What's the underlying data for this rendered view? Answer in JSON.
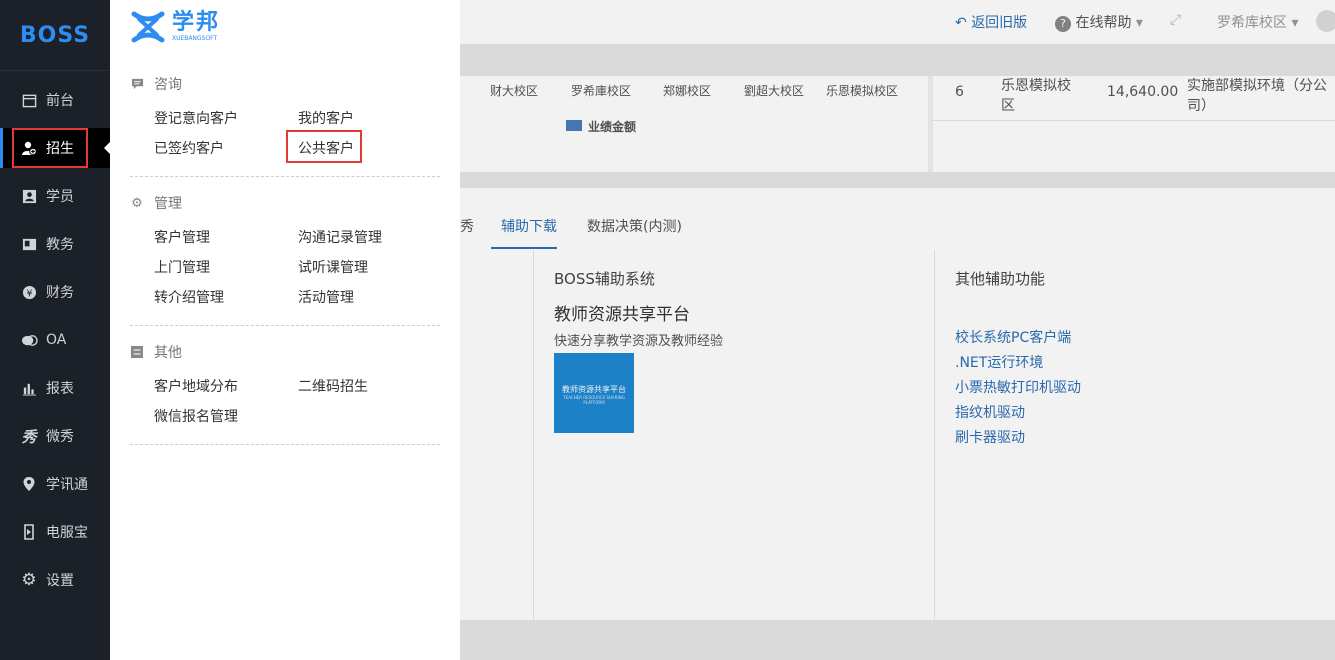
{
  "sidebar": {
    "logo": "BOSS",
    "items": [
      {
        "label": "前台",
        "icon": "calendar-icon"
      },
      {
        "label": "招生",
        "icon": "user-add-icon"
      },
      {
        "label": "学员",
        "icon": "student-card-icon"
      },
      {
        "label": "教务",
        "icon": "book-icon"
      },
      {
        "label": "财务",
        "icon": "yen-coin-icon"
      },
      {
        "label": "OA",
        "icon": "chat-bubbles-icon"
      },
      {
        "label": "报表",
        "icon": "bar-chart-icon"
      },
      {
        "label": "微秀",
        "icon": "weixiu-icon"
      },
      {
        "label": "学讯通",
        "icon": "location-pin-icon"
      },
      {
        "label": "电服宝",
        "icon": "phone-tag-icon"
      },
      {
        "label": "设置",
        "icon": "gear-icon"
      }
    ],
    "active_index": 1
  },
  "menu": {
    "logo_text": "学邦",
    "logo_sub": "XUEBANGSOFT",
    "sections": [
      {
        "title": "咨询",
        "icon": "message-icon",
        "items": [
          "登记意向客户",
          "我的客户",
          "已签约客户",
          "公共客户"
        ]
      },
      {
        "title": "管理",
        "icon": "gear-small-icon",
        "items": [
          "客户管理",
          "沟通记录管理",
          "上门管理",
          "试听课管理",
          "转介绍管理",
          "活动管理"
        ]
      },
      {
        "title": "其他",
        "icon": "grid-icon",
        "items": [
          "客户地域分布",
          "二维码招生",
          "微信报名管理"
        ]
      }
    ],
    "highlighted_item": "公共客户"
  },
  "topbar": {
    "back_label": "返回旧版",
    "help_label": "在线帮助",
    "campus_label": "罗希库校区"
  },
  "chart_area": {
    "campus_labels": [
      "财大校区",
      "罗希庫校区",
      "郑娜校区",
      "劉超大校区",
      "乐恩模拟校区"
    ],
    "legend": "业绩金额"
  },
  "table": {
    "rank": "6",
    "campus": "乐恩模拟校区",
    "amount": "14,640.00",
    "note": "实施部模拟环境（分公司）"
  },
  "tabs": [
    "秀",
    "辅助下载",
    "数据决策(内测)"
  ],
  "active_tab": "辅助下载",
  "downloads": {
    "boss_title": "BOSS辅助系统",
    "platform_title": "教师资源共享平台",
    "platform_desc": "快速分享教学资源及教师经验",
    "thumb_text": "教师资源共享平台",
    "thumb_sub": "TEACHER RESOURCE SHARING PLATFORM",
    "other_title": "其他辅助功能",
    "links": [
      "校长系统PC客户端",
      ".NET运行环境",
      "小票热敏打印机驱动",
      "指纹机驱动",
      "刷卡器驱动"
    ]
  }
}
